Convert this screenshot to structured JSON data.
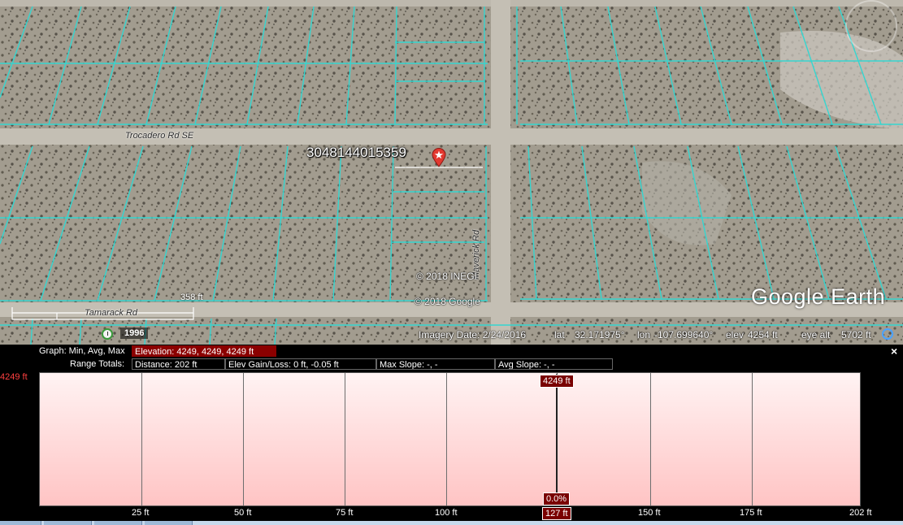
{
  "map": {
    "roads": [
      "Trocadero Rd SE",
      "Maverick Rd",
      "Tamarack Rd"
    ],
    "parcel_id": "3048144015359",
    "copyrights": [
      "© 2018 INEGI",
      "© 2018 Google"
    ],
    "logo": "Google Earth",
    "scale_label": "358 ft",
    "historical_year": "1996",
    "status": {
      "imagery_date": "Imagery Date: 2/24/2016",
      "lat_label": "lat",
      "lat": "32.171975°",
      "lon_label": "lon",
      "lon": "-107.699640°",
      "elev_label": "elev",
      "elev": "4254 ft",
      "eye_alt_label": "eye alt",
      "eye_alt": "5702 ft"
    },
    "icons": [
      "placemark-icon",
      "clock-icon",
      "nav-icon",
      "compass-icon"
    ]
  },
  "profile": {
    "graph_label": "Graph: Min, Avg, Max",
    "elevation": "Elevation: 4249, 4249, 4249 ft",
    "range_label": "Range Totals:",
    "distance": "Distance: 202 ft",
    "elev_gain_loss": "Elev Gain/Loss: 0 ft, -0.05 ft",
    "max_slope": "Max Slope: -, -",
    "avg_slope": "Avg Slope: -, -",
    "close": "×",
    "cursor_elevation": "4249 ft",
    "cursor_slope": "0.0%",
    "cursor_distance": "127 ft",
    "accent_color": "#8b0000"
  },
  "chart_data": {
    "type": "area",
    "x": [
      0,
      202
    ],
    "y": [
      4249,
      4249
    ],
    "xlabel": "",
    "ylabel": "",
    "xlim": [
      0,
      202
    ],
    "x_ticks": [
      "25 ft",
      "50 ft",
      "75 ft",
      "100 ft",
      "127 ft",
      "150 ft",
      "175 ft",
      "202 ft"
    ],
    "y_tick_labels": [
      "4249 ft"
    ],
    "grid": true,
    "cursor_x": 127
  }
}
